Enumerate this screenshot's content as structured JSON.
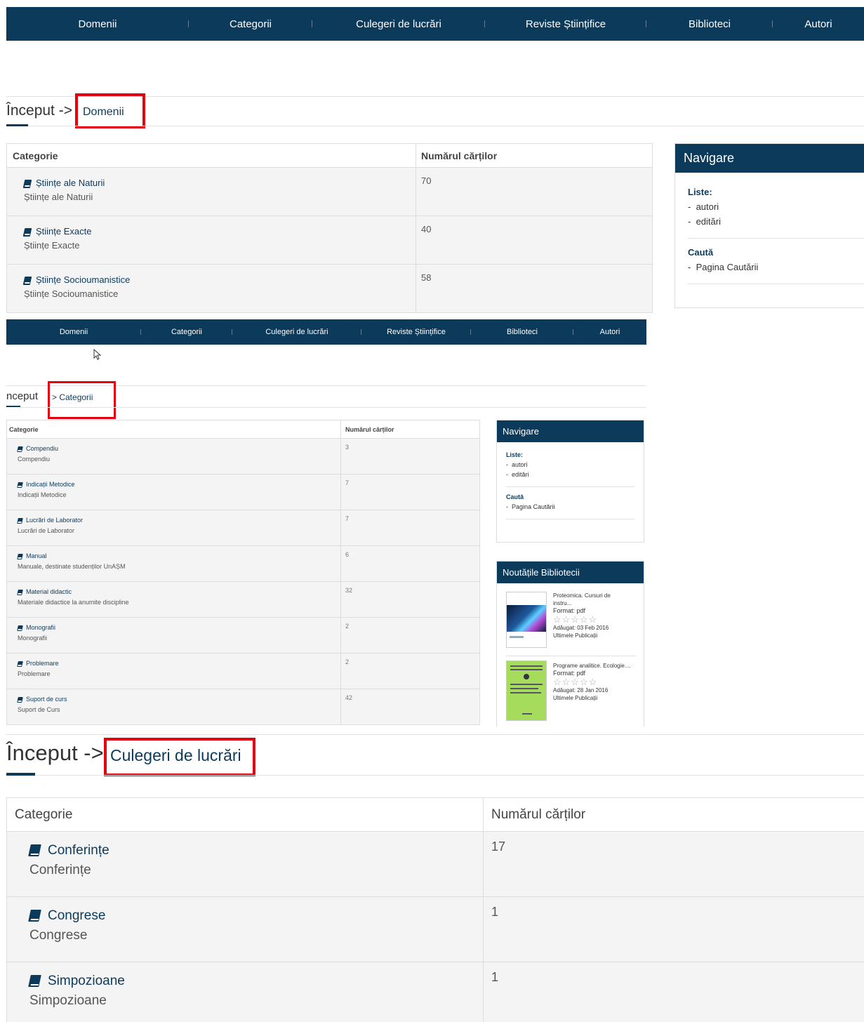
{
  "nav": [
    "Domenii",
    "Categorii",
    "Culegeri de lucrări",
    "Reviste Științifice",
    "Biblioteci",
    "Autori"
  ],
  "section1": {
    "crumb_home": "Început ->",
    "crumb_current": "Domenii",
    "col_category": "Categorie",
    "col_count": "Numărul cărților",
    "rows": [
      {
        "title": "Științe ale Naturii",
        "desc": "Științe ale Naturii",
        "count": "70"
      },
      {
        "title": "Științe Exacte",
        "desc": "Științe Exacte",
        "count": "40"
      },
      {
        "title": "Științe Socioumanistice",
        "desc": "Științe Socioumanistice",
        "count": "58"
      }
    ],
    "navigare": {
      "title": "Navigare",
      "lists_label": "Liste:",
      "lists": [
        "autori",
        "editări"
      ],
      "search_label": "Caută",
      "search_items": [
        "Pagina Cautării"
      ]
    }
  },
  "section2": {
    "crumb_home": "nceput",
    "crumb_current": "> Categorii",
    "col_category": "Categorie",
    "col_count": "Numărul cărților",
    "rows": [
      {
        "title": "Compendiu",
        "desc": "Compendiu",
        "count": "3"
      },
      {
        "title": "Indicații Metodice",
        "desc": "Indicații Metodice",
        "count": "7"
      },
      {
        "title": "Lucrări de Laborator",
        "desc": "Lucrări de Laborator",
        "count": "7"
      },
      {
        "title": "Manual",
        "desc": "Manuale, destinate studenților UnAȘM",
        "count": "6"
      },
      {
        "title": "Material didactic",
        "desc": "Materiale didactice la anumite discipline",
        "count": "32"
      },
      {
        "title": "Monografii",
        "desc": "Monografii",
        "count": "2"
      },
      {
        "title": "Problemare",
        "desc": "Problemare",
        "count": "2"
      },
      {
        "title": "Suport de curs",
        "desc": "Suport de Curs",
        "count": "42"
      }
    ],
    "navigare": {
      "title": "Navigare",
      "lists_label": "Liste:",
      "lists": [
        "autori",
        "editări"
      ],
      "search_label": "Caută",
      "search_items": [
        "Pagina Cautării"
      ]
    },
    "news": {
      "title": "Noutățile Bibliotecii",
      "items": [
        {
          "title1": "Proteomica. Cursuri de",
          "title2": "instru...",
          "format": "Format: pdf",
          "stars": "☆☆☆☆☆",
          "added": "Adăugat: 03 Feb 2016",
          "link": "Ultimele Publicații"
        },
        {
          "title1": "Programe analitice. Ecologie....",
          "title2": "",
          "format": "Format: pdf",
          "stars": "☆☆☆☆☆",
          "added": "Adăugat: 28 Jan 2016",
          "link": "Ultimele Publicații"
        }
      ]
    }
  },
  "section3": {
    "crumb_home": "Început ->",
    "crumb_current": "Culegeri de lucrări",
    "col_category": "Categorie",
    "col_count": "Numărul cărților",
    "rows": [
      {
        "title": "Conferințe",
        "desc": "Conferințe",
        "count": "17"
      },
      {
        "title": "Congrese",
        "desc": "Congrese",
        "count": "1"
      },
      {
        "title": "Simpozioane",
        "desc": "Simpozioane",
        "count": "1"
      }
    ]
  },
  "colors": {
    "navy": "#0c3a5b",
    "red": "#e3000f"
  }
}
